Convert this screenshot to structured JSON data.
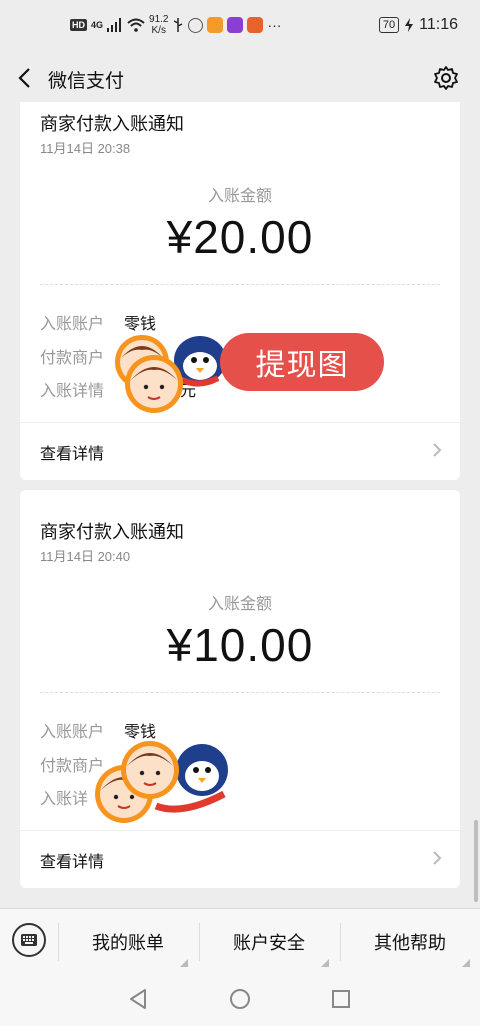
{
  "status": {
    "net_badge": "HD",
    "net_type": "4G",
    "speed_value": "91.2",
    "speed_unit": "K/s",
    "battery": "70",
    "time": "11:16",
    "more": "···"
  },
  "nav": {
    "title": "微信支付"
  },
  "cards": [
    {
      "title": "商家付款入账通知",
      "time": "11月14日  20:38",
      "amount_label": "入账金额",
      "amount": "¥20.00",
      "account_key": "入账账户",
      "account_value": "零钱",
      "merchant_key": "付款商户",
      "detail_key": "入账详情",
      "detail_partial": "元",
      "view_details": "查看详情"
    },
    {
      "title": "商家付款入账通知",
      "time": "11月14日  20:40",
      "amount_label": "入账金额",
      "amount": "¥10.00",
      "account_key": "入账账户",
      "account_value": "零钱",
      "merchant_key": "付款商户",
      "detail_key": "入账详",
      "view_details": "查看详情"
    }
  ],
  "overlay": {
    "bubble_text": "提现图"
  },
  "bottom_menu": [
    "我的账单",
    "账户安全",
    "其他帮助"
  ],
  "colors": {
    "accent_red": "#e5504b",
    "background": "#ededed"
  }
}
